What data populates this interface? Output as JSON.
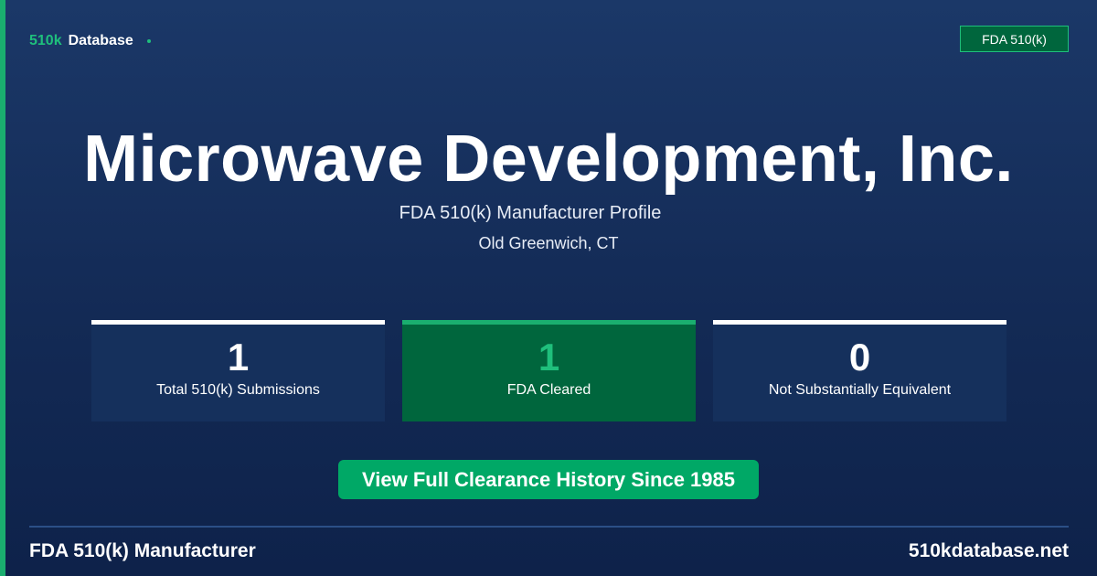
{
  "brand": {
    "accent": "510k",
    "rest": "Database"
  },
  "badge": "FDA 510(k)",
  "company_name": "Microwave Development, Inc.",
  "subtitle": "FDA 510(k) Manufacturer Profile",
  "location": "Old Greenwich, CT",
  "stats": [
    {
      "value": "1",
      "label": "Total 510(k) Submissions"
    },
    {
      "value": "1",
      "label": "FDA Cleared"
    },
    {
      "value": "0",
      "label": "Not Substantially Equivalent"
    }
  ],
  "cta_label": "View Full Clearance History Since 1985",
  "footer": {
    "left": "FDA 510(k) Manufacturer",
    "right": "510kdatabase.net"
  },
  "colors": {
    "accent_green": "#1fbf7c",
    "dark_green": "#00663d",
    "cta_green": "#00a866",
    "navy_top": "#1b3868",
    "navy_bottom": "#0e224a"
  }
}
